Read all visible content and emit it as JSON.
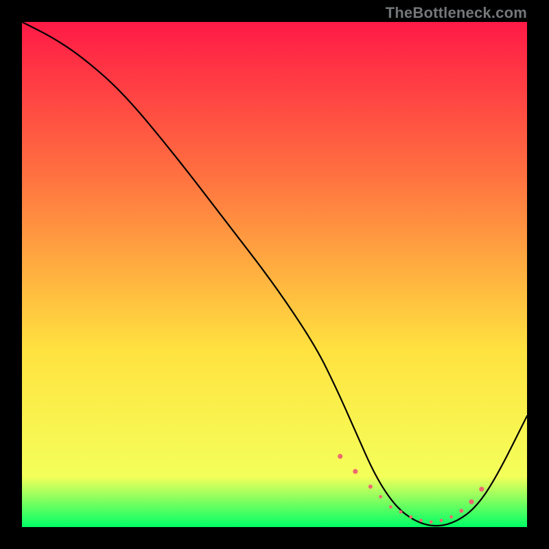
{
  "watermark": "TheBottleneck.com",
  "colors": {
    "bg_frame": "#000000",
    "grad_top": "#ff1a46",
    "grad_mid1": "#ff7040",
    "grad_mid2": "#ffe240",
    "grad_mid3": "#f4ff5a",
    "grad_bottom": "#00ff66",
    "curve": "#000000",
    "marker": "#ec6a6f"
  },
  "chart_data": {
    "type": "line",
    "title": "",
    "xlabel": "",
    "ylabel": "",
    "xlim": [
      0,
      100
    ],
    "ylim": [
      0,
      100
    ],
    "series": [
      {
        "name": "bottleneck-curve",
        "x": [
          0,
          6,
          12,
          20,
          30,
          40,
          50,
          58,
          62,
          66,
          70,
          74,
          78,
          82,
          86,
          90,
          94,
          100
        ],
        "y": [
          100,
          97,
          93,
          86,
          74,
          61,
          48,
          36,
          28,
          19,
          10,
          4,
          1,
          0,
          1,
          4,
          10,
          22
        ]
      }
    ],
    "markers": {
      "name": "highlight-band",
      "x": [
        63,
        66,
        69,
        71,
        73,
        75,
        77,
        79,
        81,
        83,
        85,
        87,
        89,
        91
      ],
      "y": [
        14,
        11,
        8,
        6,
        4,
        3,
        2,
        1.3,
        1,
        1.3,
        2,
        3.2,
        5,
        7.5
      ],
      "r": [
        3.6,
        3.6,
        3.0,
        2.4,
        2.4,
        2.4,
        2.4,
        2.4,
        2.4,
        2.4,
        2.4,
        3.0,
        3.6,
        3.6
      ]
    }
  }
}
